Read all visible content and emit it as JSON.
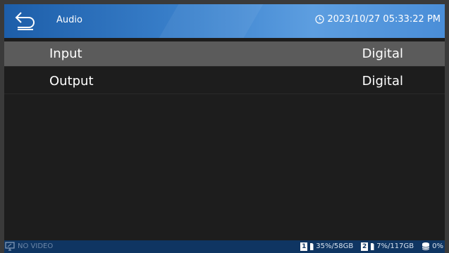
{
  "header": {
    "title": "Audio",
    "datetime": "2023/10/27 05:33:22 PM"
  },
  "settings": {
    "rows": [
      {
        "label": "Input",
        "value": "Digital",
        "selected": true
      },
      {
        "label": "Output",
        "value": "Digital",
        "selected": false
      }
    ]
  },
  "status": {
    "video": "NO VIDEO",
    "storage1_index": "1",
    "storage1": "35%/58GB",
    "storage2_index": "2",
    "storage2": "7%/117GB",
    "storage3": "0%"
  },
  "colors": {
    "header_start": "#1d5ea9",
    "header_end": "#5d9ee0",
    "selected_row": "#5b5b5b",
    "statusbar": "#0f3562"
  },
  "icons": [
    "back-arrow-icon",
    "clock-icon",
    "monitor-icon",
    "sd-card-icon",
    "database-icon"
  ]
}
